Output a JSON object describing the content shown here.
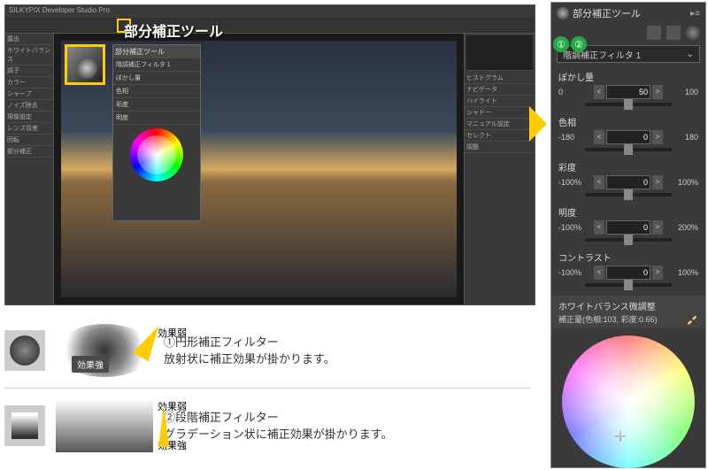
{
  "app": {
    "title": "SILKYPIX Developer Studio Pro",
    "callout": "部分補正ツール"
  },
  "left_panel_items": [
    "露出",
    "ホワイトバランス",
    "調子",
    "カラー",
    "シャープ",
    "ノイズ除去",
    "現像設定",
    "レンズ収差",
    "回転",
    "部分補正"
  ],
  "right_panel_items": [
    "ヒストグラム",
    "ナビゲータ",
    "ハイライト",
    "シャドー",
    "マニュアル設定",
    "セレクト",
    "調整"
  ],
  "mini_panel": {
    "title": "部分補正ツール",
    "dropdown": "階調補正フィルタ 1",
    "rows": [
      "ぼかし量",
      "色相",
      "彩度",
      "明度"
    ]
  },
  "panel": {
    "title": "部分補正ツール",
    "menu_glyph": "▸≡",
    "marker1": "①",
    "marker2": "②",
    "dropdown": "階調補正フィルタ 1",
    "dropdown_arrow": "⌄",
    "sliders": [
      {
        "label": "ぼかし量",
        "min": "0",
        "max": "100",
        "value": "50"
      },
      {
        "label": "色相",
        "min": "-180",
        "max": "180",
        "value": "0"
      },
      {
        "label": "彩度",
        "min": "-100%",
        "max": "100%",
        "value": "0"
      },
      {
        "label": "明度",
        "min": "-100%",
        "max": "200%",
        "value": "0"
      },
      {
        "label": "コントラスト",
        "min": "-100%",
        "max": "100%",
        "value": "0"
      }
    ],
    "wb_label": "ホワイトバランス微調整",
    "wb_sub": "補正量(色相:103, 彩度:0.66)"
  },
  "legend": {
    "weak": "効果弱",
    "strong": "効果強",
    "item1_title": "①円形補正フィルター",
    "item1_desc": "放射状に補正効果が掛かります。",
    "item2_title": "②段階補正フィルター",
    "item2_desc": "グラデーション状に補正効果が掛かります。"
  }
}
